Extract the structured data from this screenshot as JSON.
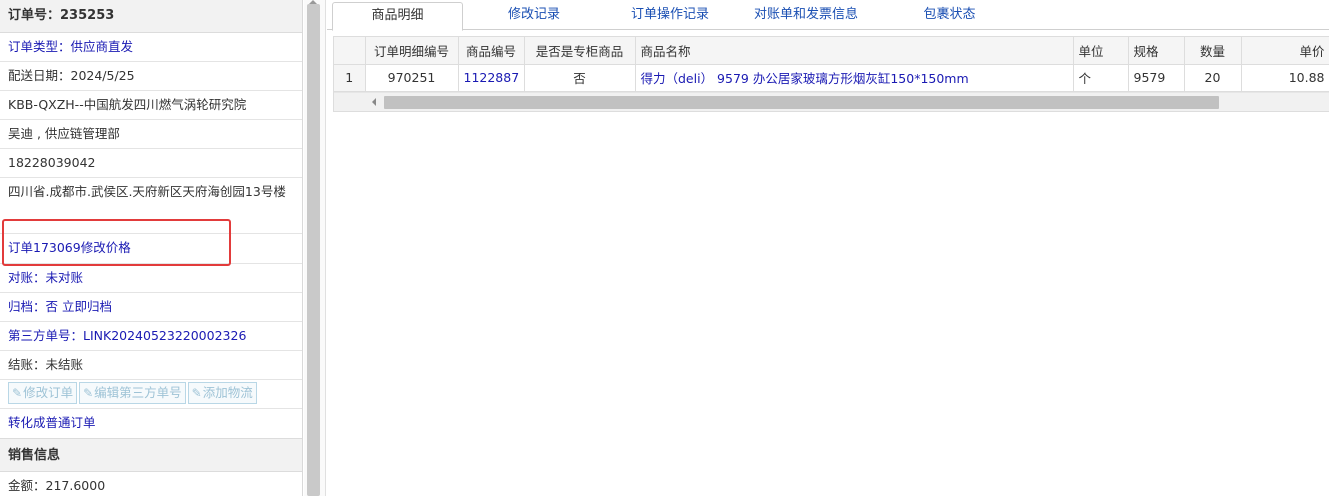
{
  "order": {
    "number_label": "订单号：",
    "number": "235253",
    "type": "订单类型：供应商直发",
    "delivery_date": "配送日期：2024/5/25",
    "customer": "KBB-QXZH--中国航发四川燃气涡轮研究院",
    "contact": "吴迪 , 供应链管理部",
    "phone": "18228039042",
    "address": "四川省.成都市.武侯区.天府新区天府海创园13号楼",
    "price_change": "订单173069修改价格",
    "reconcile": "对账：未对账",
    "archive_label": "归档：",
    "archive_value": "否",
    "archive_link": "立即归档",
    "third_party": "第三方单号：LINK20240523220002326",
    "settlement": "结账：未结账",
    "buttons": {
      "edit_order": "修改订单",
      "edit_third_party": "编辑第三方单号",
      "add_logistics": "添加物流"
    },
    "convert": "转化成普通订单"
  },
  "sales": {
    "title": "销售信息",
    "amount": "金额：217.6000"
  },
  "tabs": [
    {
      "label": "商品明细",
      "active": true
    },
    {
      "label": "修改记录",
      "active": false
    },
    {
      "label": "订单操作记录",
      "active": false
    },
    {
      "label": "对账单和发票信息",
      "active": false
    },
    {
      "label": "包裹状态",
      "active": false
    }
  ],
  "grid": {
    "columns": [
      "订单明细编号",
      "商品编号",
      "是否是专柜商品",
      "商品名称",
      "单位",
      "规格",
      "数量",
      "单价"
    ],
    "rows": [
      {
        "index": "1",
        "detail_id": "970251",
        "product_id": "1122887",
        "is_counter": "否",
        "name": "得力（deli） 9579 办公居家玻璃方形烟灰缸150*150mm",
        "unit": "个",
        "spec": "9579",
        "qty": "20",
        "price": "10.88"
      }
    ]
  },
  "colors": {
    "highlight": "#e23b3b",
    "link": "#1a1ab3"
  }
}
